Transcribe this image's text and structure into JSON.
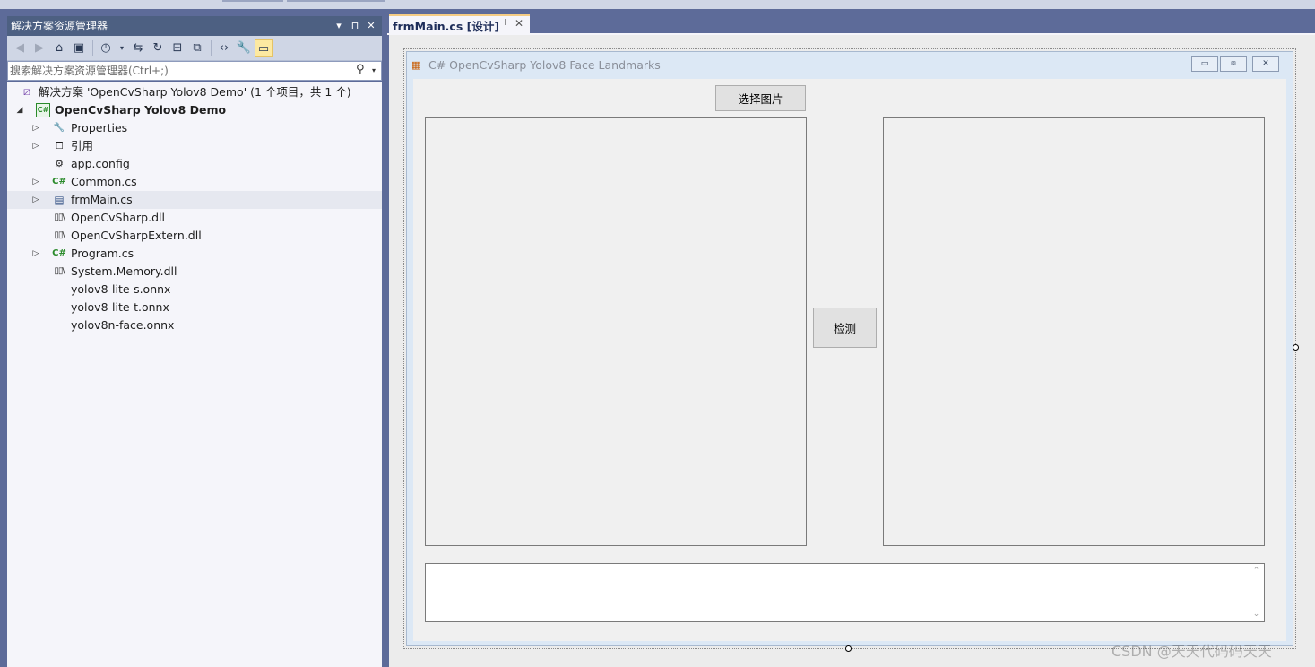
{
  "solution_explorer": {
    "title": "解决方案资源管理器",
    "search_placeholder": "搜索解决方案资源管理器(Ctrl+;)",
    "tree": [
      {
        "label": "解决方案 'OpenCvSharp Yolov8 Demo' (1 个项目，共 1 个)",
        "icon": "solution-icon",
        "expander": "none"
      },
      {
        "label": "OpenCvSharp Yolov8 Demo",
        "icon": "csharp-project-icon",
        "expander": "expanded",
        "bold": true
      },
      {
        "label": "Properties",
        "icon": "wrench-icon",
        "expander": "collapsed"
      },
      {
        "label": "引用",
        "icon": "references-icon",
        "expander": "collapsed"
      },
      {
        "label": "app.config",
        "icon": "config-file-icon",
        "expander": "none"
      },
      {
        "label": "Common.cs",
        "icon": "csharp-file-icon",
        "expander": "collapsed"
      },
      {
        "label": "frmMain.cs",
        "icon": "form-file-icon",
        "expander": "collapsed",
        "selected": true
      },
      {
        "label": "OpenCvSharp.dll",
        "icon": "dll-icon",
        "expander": "none"
      },
      {
        "label": "OpenCvSharpExtern.dll",
        "icon": "dll-icon",
        "expander": "none"
      },
      {
        "label": "Program.cs",
        "icon": "csharp-file-icon",
        "expander": "collapsed"
      },
      {
        "label": "System.Memory.dll",
        "icon": "dll-icon",
        "expander": "none"
      },
      {
        "label": "yolov8-lite-s.onnx",
        "icon": "",
        "expander": "none"
      },
      {
        "label": "yolov8-lite-t.onnx",
        "icon": "",
        "expander": "none"
      },
      {
        "label": "yolov8n-face.onnx",
        "icon": "",
        "expander": "none"
      }
    ]
  },
  "editor": {
    "tab_label": "frmMain.cs [设计]"
  },
  "form": {
    "title": "C# OpenCvSharp Yolov8 Face Landmarks",
    "select_button": "选择图片",
    "detect_button": "检测"
  },
  "watermark": "CSDN @天天代码码天天",
  "colors": {
    "ide_background": "#5d6b99",
    "panel_title": "#4d6082",
    "tab_accent": "#f5cc84",
    "form_client": "#f0f0f0"
  }
}
